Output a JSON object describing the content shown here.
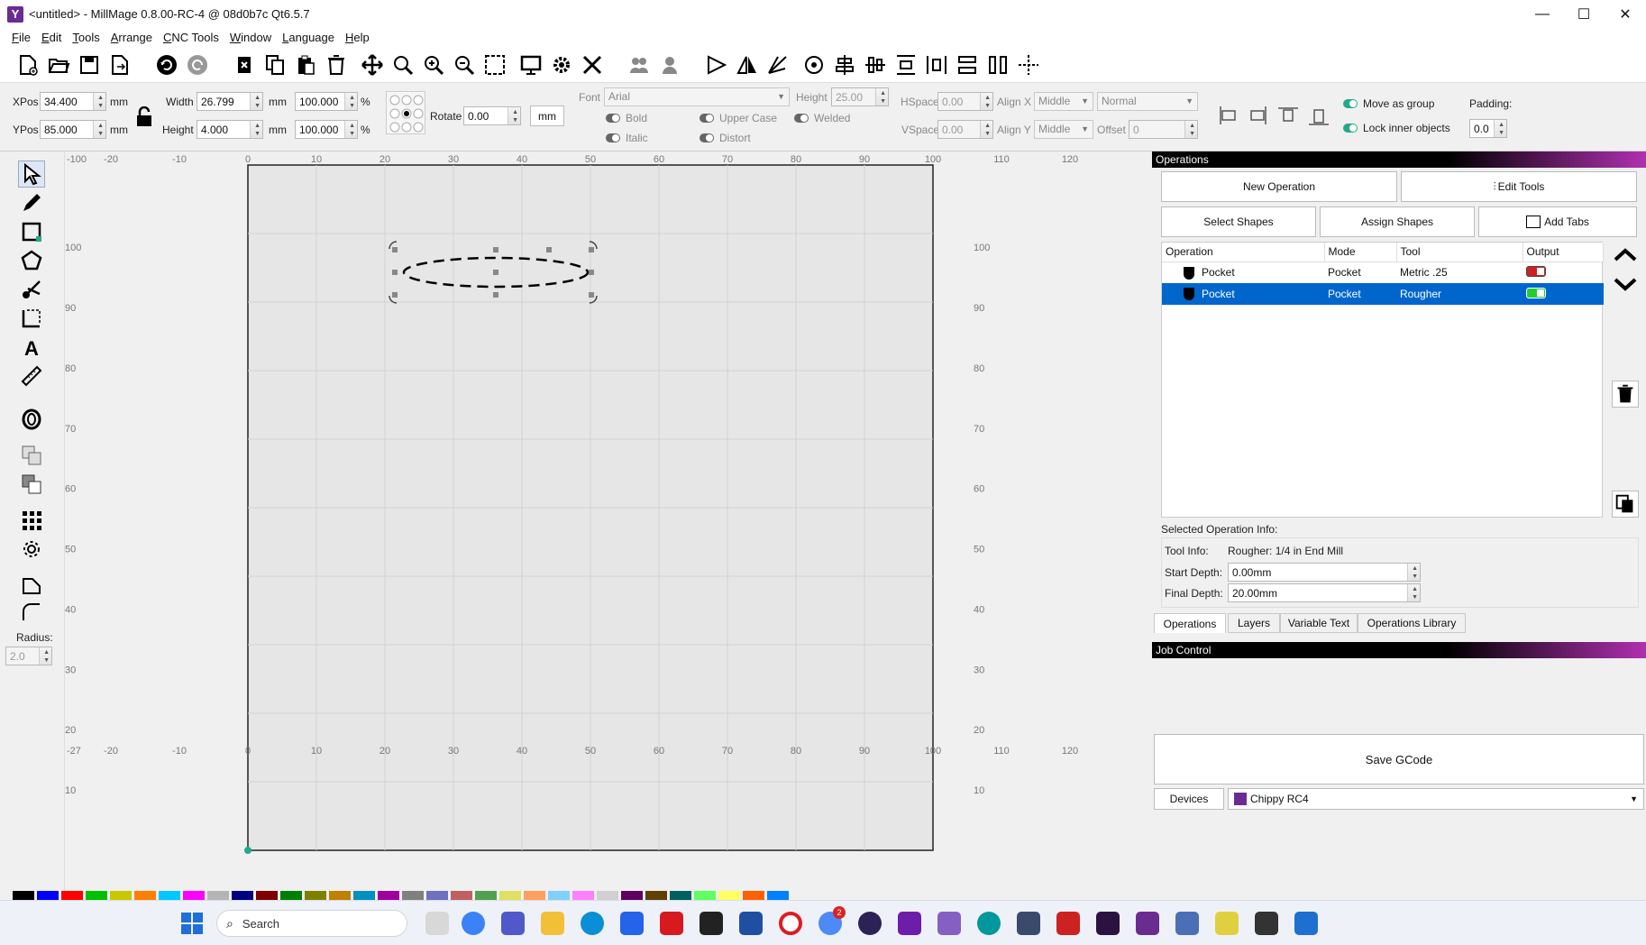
{
  "window": {
    "title": "<untitled> - MillMage 0.8.00-RC-4 @ 08d0b7c Qt6.5.7",
    "min": "—",
    "max": "☐",
    "close": "✕"
  },
  "menu": [
    "File",
    "Edit",
    "Tools",
    "Arrange",
    "CNC Tools",
    "Window",
    "Language",
    "Help"
  ],
  "props": {
    "xpos_label": "XPos",
    "xpos": "34.400",
    "ypos_label": "YPos",
    "ypos": "85.000",
    "unit": "mm",
    "width_label": "Width",
    "width": "26.799",
    "height_label": "Height",
    "height": "4.000",
    "pct_w": "100.000",
    "pct_h": "100.000",
    "pct": "%",
    "rotate_label": "Rotate",
    "rotate": "0.00",
    "mm_button": "mm",
    "font_label": "Font",
    "font": "Arial",
    "fheight_label": "Height",
    "fheight": "25.00",
    "bold": "Bold",
    "italic": "Italic",
    "upper": "Upper Case",
    "distort": "Distort",
    "welded": "Welded",
    "hspace_label": "HSpace",
    "hspace": "0.00",
    "vspace_label": "VSpace",
    "vspace": "0.00",
    "alignx_label": "Align X",
    "alignx": "Middle",
    "aligny_label": "Align Y",
    "aligny": "Middle",
    "normal": "Normal",
    "offset_label": "Offset",
    "offset": "0",
    "move_group": "Move as group",
    "lock_inner": "Lock inner objects",
    "padding_label": "Padding:",
    "padding": "0.0"
  },
  "left": {
    "radius_label": "Radius:",
    "radius": "2.0"
  },
  "ruler": {
    "top": [
      "-20",
      "-10",
      "0",
      "10",
      "20",
      "30",
      "40",
      "50",
      "60",
      "70",
      "80",
      "90",
      "100",
      "110",
      "120"
    ],
    "left": [
      "100",
      "90",
      "80",
      "70",
      "60",
      "50",
      "40",
      "30",
      "20",
      "10"
    ],
    "left_corner": "-100",
    "bottom_corner": "-27"
  },
  "operations": {
    "title": "Operations",
    "new_op": "New Operation",
    "edit_tools": "Edit Tools",
    "select_shapes": "Select Shapes",
    "assign_shapes": "Assign Shapes",
    "add_tabs": "Add Tabs",
    "headers": [
      "Operation",
      "Mode",
      "Tool",
      "Output"
    ],
    "rows": [
      {
        "op": "Pocket",
        "mode": "Pocket",
        "tool": "Metric .25",
        "output": "off"
      },
      {
        "op": "Pocket",
        "mode": "Pocket",
        "tool": "Rougher",
        "output": "on"
      }
    ],
    "info_title": "Selected Operation Info:",
    "tool_info_label": "Tool Info:",
    "tool_info": "Rougher: 1/4 in End Mill",
    "start_label": "Start Depth:",
    "start": "0.00mm",
    "final_label": "Final Depth:",
    "final": "20.00mm",
    "tabs": [
      "Operations",
      "Layers",
      "Variable Text",
      "Operations Library"
    ]
  },
  "job": {
    "title": "Job Control",
    "save": "Save GCode",
    "devices": "Devices",
    "device": "Chippy RC4"
  },
  "taskbar": {
    "search": "Search",
    "badge": "2"
  },
  "palette": [
    "#000000",
    "#0000ff",
    "#ff0000",
    "#00c000",
    "#c8c800",
    "#ff8000",
    "#00c8ff",
    "#ff00ff",
    "#b4b4b4",
    "#000080",
    "#800000",
    "#008000",
    "#808000",
    "#c08000",
    "#0090c0",
    "#a000a0",
    "#808080",
    "#7070c0",
    "#c06060",
    "#50a050",
    "#e0e060",
    "#ffa060",
    "#80d0ff",
    "#ff80ff",
    "#d0d0d0",
    "#600060",
    "#604000",
    "#006060",
    "#60ff60",
    "#ffff60",
    "#ff6000",
    "#0080ff"
  ]
}
